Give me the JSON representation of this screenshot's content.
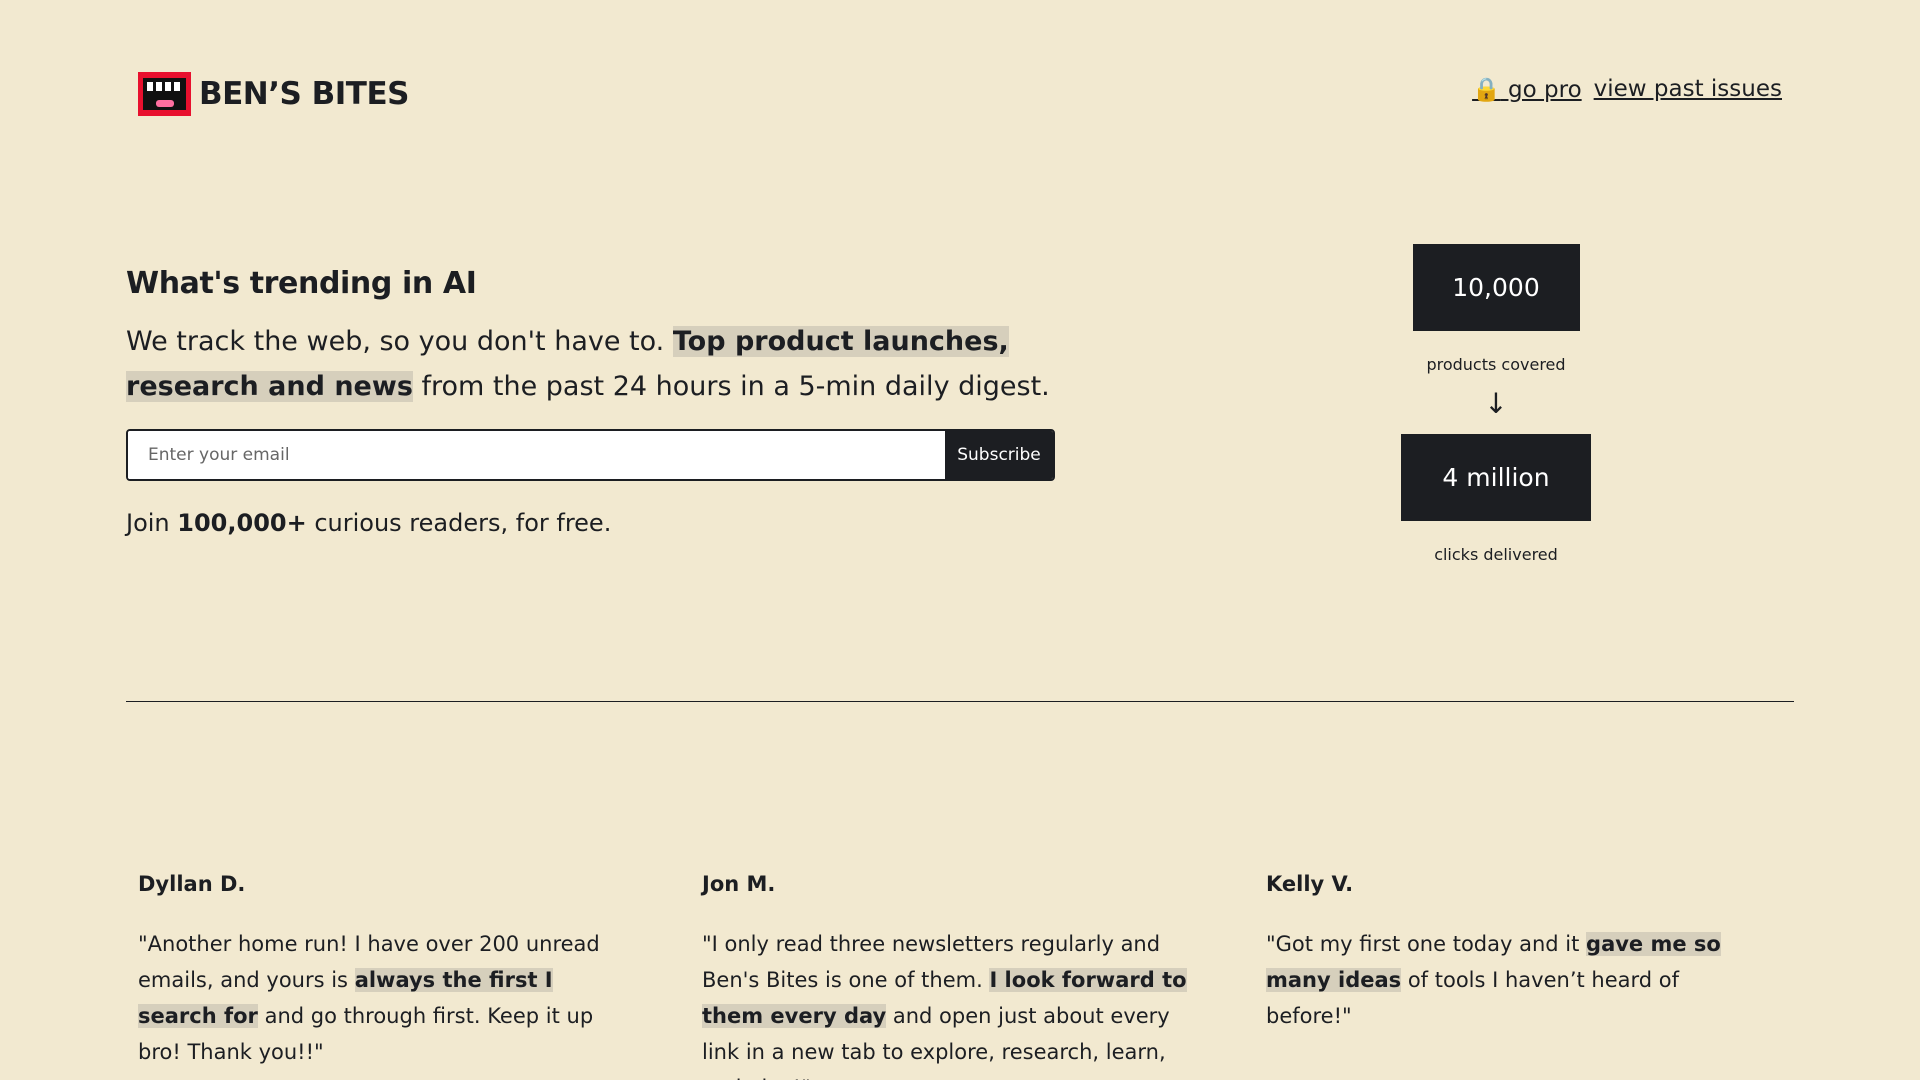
{
  "brand": {
    "name": "BEN’S BITES",
    "logo_icon": "mouth-logo-icon"
  },
  "nav": {
    "go_pro_icon": "🔒",
    "go_pro": "go pro",
    "past_issues": "view past issues"
  },
  "hero": {
    "title": "What's trending in AI",
    "desc_part1": "We track the web, so you don't have to. ",
    "desc_highlight": "Top product launches, research and news",
    "desc_part2": " from the past 24 hours in a 5-min daily digest.",
    "email_placeholder": "Enter your email",
    "subscribe_label": "Subscribe",
    "join_prefix": "Join ",
    "join_count": "100,000+",
    "join_suffix": " curious readers, for free."
  },
  "stats": {
    "products_value": "10,000",
    "products_label": "products covered",
    "arrow": "↓",
    "clicks_value": "4 million",
    "clicks_label": "clicks delivered"
  },
  "testimonials": [
    {
      "name": "Dyllan D.",
      "pre": "\"Another home run! I have over 200 unread emails, and yours is ",
      "highlight": "always the first I search for",
      "post": " and go through first. Keep it up bro! Thank you!!\""
    },
    {
      "name": "Jon M.",
      "pre": "\"I only read three newsletters regularly and Ben's Bites is one of them. ",
      "highlight": "I look forward to them every day",
      "post": " and open just about every link in a new tab to explore, research, learn, and play!\""
    },
    {
      "name": "Kelly V.",
      "pre": "\"Got my first one today and it ",
      "highlight": "gave me so many ideas",
      "post": " of tools I haven’t heard of before!\""
    }
  ],
  "colors": {
    "background": "#f2e9d0",
    "dark": "#1c1e22",
    "highlight": "#d6cfbc",
    "logo_red": "#e8102e"
  }
}
